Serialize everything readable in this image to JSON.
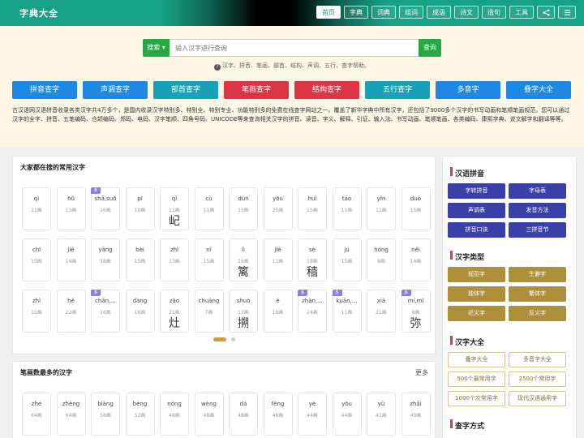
{
  "header": {
    "logo": "字典大全",
    "nav": [
      {
        "label": "首页",
        "active": true
      },
      {
        "label": "字典"
      },
      {
        "label": "词典"
      },
      {
        "label": "组词"
      },
      {
        "label": "成语"
      },
      {
        "label": "诗文"
      },
      {
        "label": "造句"
      },
      {
        "label": "工具"
      }
    ],
    "share_icon": "share-icon",
    "menu_icon": "menu-icon"
  },
  "search": {
    "mode_label": "搜索",
    "placeholder": "输入汉字进行查询",
    "submit_label": "查询",
    "hint": "汉字、拼音、笔画、部首、结构、声调、五行，查字帮助。"
  },
  "quick_links": [
    {
      "label": "拼音查字",
      "color": "#1e88e5"
    },
    {
      "label": "声调查字",
      "color": "#1e88e5"
    },
    {
      "label": "部首查字",
      "color": "#17a2b8"
    },
    {
      "label": "笔画查字",
      "color": "#dc3545"
    },
    {
      "label": "结构查字",
      "color": "#dc3545"
    },
    {
      "label": "五行查字",
      "color": "#17a2b8"
    },
    {
      "label": "多音字",
      "color": "#1e88e5"
    },
    {
      "label": "叠字大全",
      "color": "#1e88e5"
    }
  ],
  "intro": "古汉语网汉语拼音收录各类汉字共4万多个，是国内收录汉字特别多、特别全、特别专业、功能特别多的免费在线查字网站之一。覆盖了新华字典中所有汉字，还包括了9000多个汉字的书写动画和笔顺笔画规范。您可以通过汉字的全字、拼音、五笔编码、仓颉编码、郑码、电码、汉字笔顺、四角号码、UNICODE等来查询相关汉字的拼音、读音、字义、解释、引证、输入法、书写动画、笔顺笔画、各类编码、康熙字典、说文解字和翻译等等。",
  "popular": {
    "title": "大家都在搜的常用汉字",
    "items": [
      {
        "py": "qì",
        "strokes": "11画",
        "char": "",
        "multi": false
      },
      {
        "py": "hū",
        "strokes": "13画",
        "char": "",
        "multi": false
      },
      {
        "py": "shā,suō",
        "strokes": "16画",
        "char": "",
        "multi": true
      },
      {
        "py": "pī",
        "strokes": "10画",
        "char": "",
        "multi": false
      },
      {
        "py": "qǐ",
        "strokes": "11画",
        "char": "屺",
        "multi": false
      },
      {
        "py": "cù",
        "strokes": "11画",
        "char": "",
        "multi": false
      },
      {
        "py": "dùn",
        "strokes": "15画",
        "char": "",
        "multi": false
      },
      {
        "py": "yōu",
        "strokes": "25画",
        "char": "",
        "multi": false
      },
      {
        "py": "huì",
        "strokes": "15画",
        "char": "",
        "multi": false
      },
      {
        "py": "táo",
        "strokes": "11画",
        "char": "",
        "multi": false
      },
      {
        "py": "yǐn",
        "strokes": "11画",
        "char": "",
        "multi": false
      },
      {
        "py": "duò",
        "strokes": "15画",
        "char": "",
        "multi": false
      },
      {
        "py": "chī",
        "strokes": "15画",
        "char": "",
        "multi": false
      },
      {
        "py": "jiē",
        "strokes": "14画",
        "char": "",
        "multi": false
      },
      {
        "py": "yāng",
        "strokes": "18画",
        "char": "",
        "multi": false
      },
      {
        "py": "bèi",
        "strokes": "15画",
        "char": "",
        "multi": false
      },
      {
        "py": "zhì",
        "strokes": "13画",
        "char": "",
        "multi": false
      },
      {
        "py": "nǐ",
        "strokes": "15画",
        "char": "",
        "multi": false
      },
      {
        "py": "lì",
        "strokes": "16画",
        "char": "篱",
        "multi": false
      },
      {
        "py": "jiē",
        "strokes": "11画",
        "char": "",
        "multi": false
      },
      {
        "py": "sè",
        "strokes": "18画",
        "char": "穑",
        "multi": false
      },
      {
        "py": "jú",
        "strokes": "15画",
        "char": "",
        "multi": false
      },
      {
        "py": "hóng",
        "strokes": "8画",
        "char": "",
        "multi": false
      },
      {
        "py": "něi",
        "strokes": "14画",
        "char": "",
        "multi": false
      },
      {
        "py": "zhì",
        "strokes": "15画",
        "char": "",
        "multi": false
      },
      {
        "py": "hé",
        "strokes": "22画",
        "char": "",
        "multi": false
      },
      {
        "py": "chān,...",
        "strokes": "16画",
        "char": "",
        "multi": true
      },
      {
        "py": "dàng",
        "strokes": "16画",
        "char": "",
        "multi": false
      },
      {
        "py": "zào",
        "strokes": "21画",
        "char": "灶",
        "multi": false
      },
      {
        "py": "chuàng",
        "strokes": "7画",
        "char": "",
        "multi": false
      },
      {
        "py": "shuò",
        "strokes": "13画",
        "char": "搠",
        "multi": false
      },
      {
        "py": "è",
        "strokes": "16画",
        "char": "",
        "multi": false
      },
      {
        "py": "zhàn,...",
        "strokes": "24画",
        "char": "",
        "multi": true
      },
      {
        "py": "kuān,...",
        "strokes": "11画",
        "char": "",
        "multi": true
      },
      {
        "py": "xiá",
        "strokes": "21画",
        "char": "",
        "multi": false
      },
      {
        "py": "mí,mǐ",
        "strokes": "8画",
        "char": "弥",
        "multi": true
      }
    ]
  },
  "strokes_card": {
    "title": "笔画数最多的汉字",
    "more": "更多",
    "items": [
      {
        "py": "zhé",
        "strokes": "64画"
      },
      {
        "py": "zhèng",
        "strokes": "64画"
      },
      {
        "py": "biàng",
        "strokes": "58画"
      },
      {
        "py": "bèng",
        "strokes": "52画"
      },
      {
        "py": "nóng",
        "strokes": "48画"
      },
      {
        "py": "wèng",
        "strokes": "48画"
      },
      {
        "py": "dá",
        "strokes": "48画"
      },
      {
        "py": "fēng",
        "strokes": "46画"
      },
      {
        "py": "yè",
        "strokes": "44画"
      },
      {
        "py": "yōu",
        "strokes": "44画"
      },
      {
        "py": "yù",
        "strokes": "41画"
      },
      {
        "py": "zhāi",
        "strokes": "40画"
      }
    ]
  },
  "sidebar": {
    "sections": [
      {
        "title": "汉语拼音",
        "style": "purple",
        "items": [
          "字转拼音",
          "字母表",
          "声调表",
          "发音方法",
          "拼音口诀",
          "三拼音节"
        ]
      },
      {
        "title": "汉字类型",
        "style": "gold",
        "items": [
          "规范字",
          "生僻字",
          "独体字",
          "繁体字",
          "近义字",
          "反义字"
        ]
      },
      {
        "title": "汉字大全",
        "style": "outline",
        "items": [
          "叠字大全",
          "多音字大全",
          "500个最常用字",
          "2500个常用字",
          "1000个次常用字",
          "现代汉语通用字"
        ]
      },
      {
        "title": "查字方式",
        "style": "none",
        "items": []
      }
    ]
  },
  "colors": {
    "accent": "#16a085",
    "search_green": "#28a745",
    "badge": "#8a7fe0"
  }
}
